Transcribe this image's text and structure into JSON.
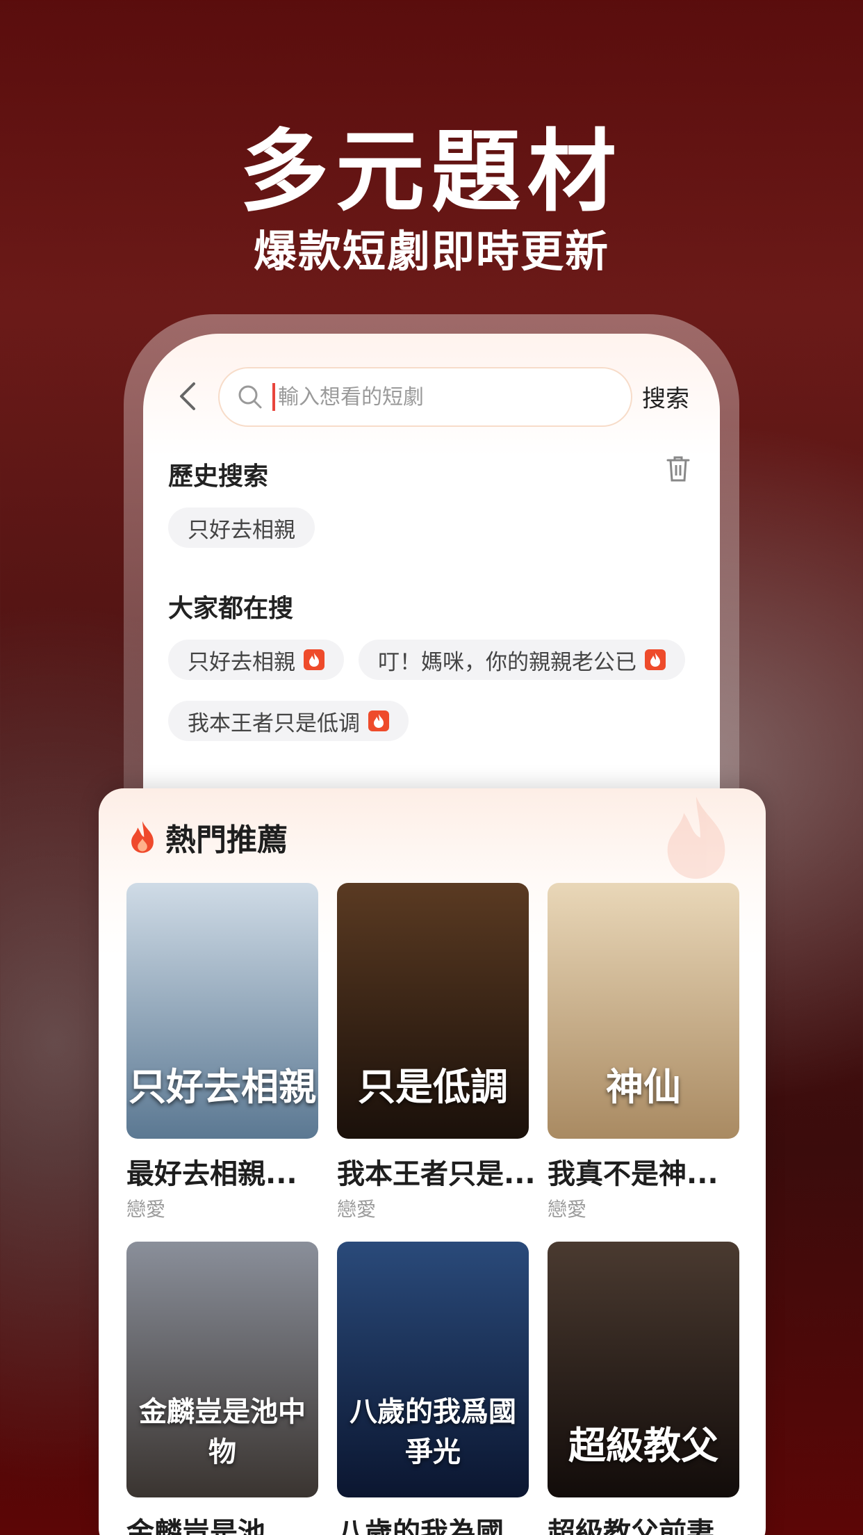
{
  "promo": {
    "headline": "多元題材",
    "subline": "爆款短劇即時更新"
  },
  "search": {
    "placeholder": "輸入想看的短劇",
    "button_label": "搜索"
  },
  "history": {
    "title": "歷史搜索",
    "items": [
      "只好去相親"
    ]
  },
  "trending": {
    "title": "大家都在搜",
    "items": [
      "只好去相親",
      "叮！媽咪，你的親親老公已",
      "我本王者只是低调"
    ]
  },
  "recommend": {
    "title": "熱門推薦",
    "dramas": [
      {
        "title": "最好去相親...",
        "genre": "戀愛",
        "poster_text": "只好去相親",
        "colors": [
          "#cfdbe6",
          "#5b7892"
        ]
      },
      {
        "title": "我本王者只是...",
        "genre": "戀愛",
        "poster_text": "只是低調",
        "colors": [
          "#5a3a22",
          "#1a100a"
        ]
      },
      {
        "title": "我真不是神...",
        "genre": "戀愛",
        "poster_text": "神仙",
        "colors": [
          "#e9d7b8",
          "#a98a62"
        ]
      },
      {
        "title": "金麟豈是池...",
        "genre": "",
        "poster_text": "金麟豈是池中物",
        "colors": [
          "#8a8f9a",
          "#3a3430"
        ]
      },
      {
        "title": "八歲的我為國...",
        "genre": "",
        "poster_text": "八歲的我爲國爭光",
        "colors": [
          "#2a4a7a",
          "#0b1630"
        ]
      },
      {
        "title": "超級教父前妻...",
        "genre": "",
        "poster_text": "超級教父",
        "colors": [
          "#4a3a30",
          "#120c0a"
        ]
      }
    ]
  }
}
